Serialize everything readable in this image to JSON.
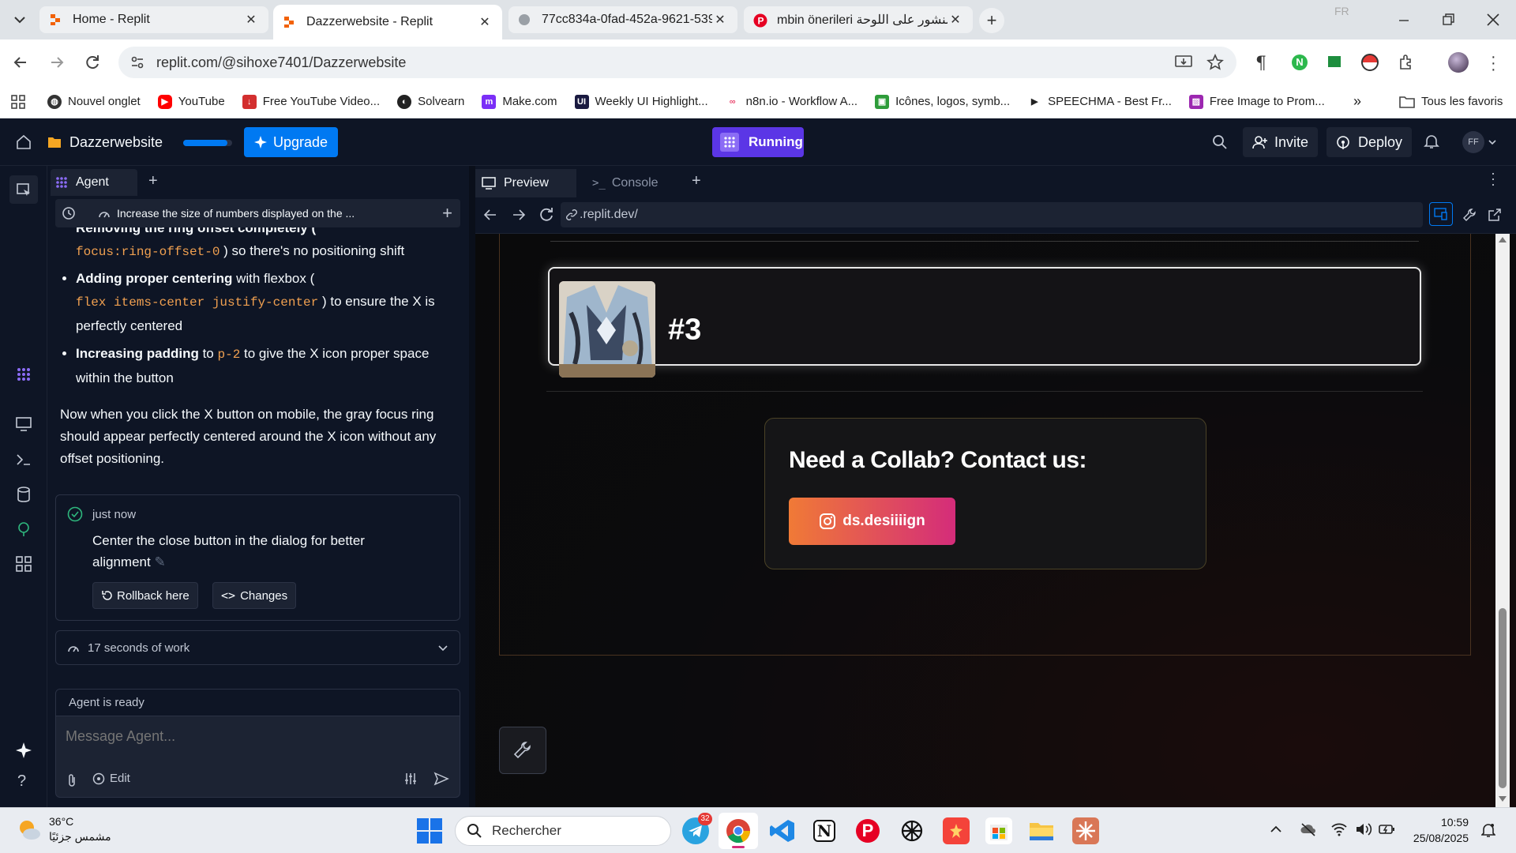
{
  "browser": {
    "tabs": [
      {
        "title": "Home - Replit"
      },
      {
        "title": "Dazzerwebsite - Replit"
      },
      {
        "title": "77cc834a-0fad-452a-9621-5390"
      },
      {
        "title": "mbin önerileri منشور على اللوحة"
      }
    ],
    "profile_badge": "FR",
    "url": "replit.com/@sihoxe7401/Dazzerwebsite",
    "bookmarks": [
      "Nouvel onglet",
      "YouTube",
      "Free YouTube Video...",
      "Solvearn",
      "Make.com",
      "Weekly UI Highlight...",
      "n8n.io - Workflow A...",
      "Icônes, logos, symb...",
      "SPEECHMA - Best Fr...",
      "Free Image to Prom..."
    ],
    "all_bookmarks": "Tous les favoris",
    "more_bookmarks": "»"
  },
  "replit": {
    "project": "Dazzerwebsite",
    "upgrade": "Upgrade",
    "running": "Running",
    "invite": "Invite",
    "deploy": "Deploy",
    "avatar": "FF",
    "agent_tab": "Agent",
    "add": "+",
    "preview_tab": "Preview",
    "console_tab": "Console",
    "preview_url": ".replit.dev/"
  },
  "agent": {
    "history_title": "Increase the size of numbers displayed on the ...",
    "cut_line": "Removing the ring offset completely (",
    "code_ring": "focus:ring-offset-0",
    "cut_rest": ") so there's no positioning shift",
    "b2_bold": "Adding proper centering",
    "b2_text": " with flexbox (",
    "code_flex": "flex items-center justify-center",
    "b2_rest": ") to ensure the X is perfectly centered",
    "b3_bold": "Increasing padding",
    "b3_text": " to ",
    "code_p2": "p-2",
    "b3_rest": " to give the X icon proper space within the button",
    "para": "Now when you click the X button on mobile, the gray focus ring should appear perfectly centered around the X icon without any offset positioning.",
    "checkpoint_time": "just now",
    "checkpoint_msg": "Center the close button in the dialog for better alignment",
    "rollback": "Rollback here",
    "changes": "Changes",
    "work": "17 seconds of work",
    "status": "Agent is ready",
    "placeholder": "Message Agent...",
    "edit": "Edit"
  },
  "site": {
    "card_number": "#3",
    "collab_title": "Need a Collab? Contact us:",
    "instagram": "ds.desiiiign"
  },
  "taskbar": {
    "temp": "36°C",
    "weather": "مشمس جزئيًا",
    "search": "Rechercher",
    "telegram_badge": "32",
    "time": "10:59",
    "date": "25/08/2025"
  },
  "colors": {
    "replit_bg": "#0e1525",
    "upgrade": "#0079f2",
    "running": "#5b36e6",
    "insta_start": "#f07a36",
    "insta_end": "#d42c7a"
  }
}
